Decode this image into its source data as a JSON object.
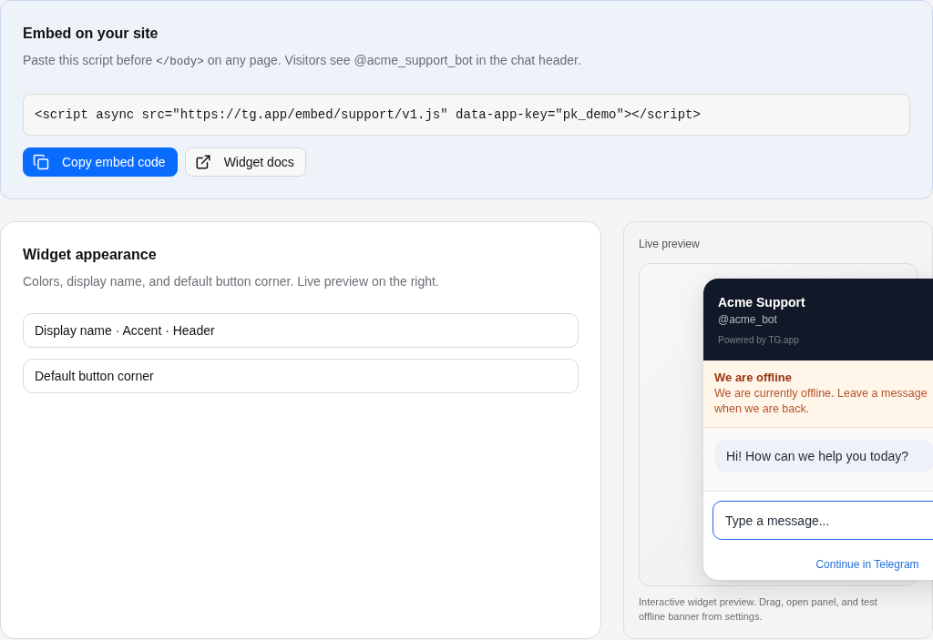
{
  "embed": {
    "title": "Embed on your site",
    "description": [
      {
        "kind": "text",
        "text": "Paste this script before"
      },
      {
        "kind": "code",
        "text": "</body>"
      },
      {
        "kind": "text",
        "text": "on any page. Visitors see @acme_support_bot in the chat header."
      }
    ],
    "snippet": "<script async src=\"https://tg.app/embed/support/v1.js\" data-app-key=\"pk_demo\"></script>",
    "actions": [
      {
        "kind": "primary",
        "label": "Copy embed code"
      },
      {
        "kind": "secondary",
        "label": "Widget docs"
      }
    ]
  },
  "appearance": {
    "title": "Widget appearance",
    "description": "Colors, display name, and default button corner. Live preview on the right.",
    "sections": [
      {
        "label": "Display name · Accent · Header"
      },
      {
        "label": "Default button corner"
      }
    ]
  },
  "preview": {
    "label": "Live preview",
    "widget": {
      "name": "Acme Support",
      "handle": "@acme_bot",
      "powered_by": "Powered by TG.app",
      "offline": {
        "title": "We are offline",
        "message": "We are currently offline. Leave a message when we are back."
      },
      "messages": [
        {
          "kind": "bot",
          "text": "Hi! How can we help you today?"
        }
      ],
      "input": {
        "placeholder": "Type a message..."
      },
      "link": "Continue in Telegram"
    },
    "caption": "Interactive widget preview. Drag, open panel, and test offline banner from settings."
  }
}
